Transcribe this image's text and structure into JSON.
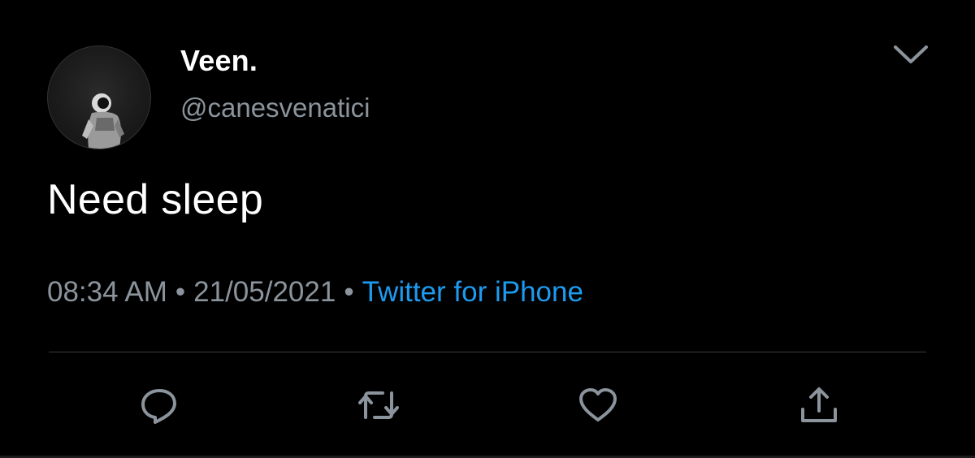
{
  "tweet": {
    "display_name": "Veen.",
    "handle": "@canesvenatici",
    "text": "Need sleep",
    "time": "08:34 AM",
    "date": "21/05/2021",
    "separator": "•",
    "source": "Twitter for iPhone"
  },
  "icons": {
    "menu": "chevron-down-icon",
    "reply": "reply-icon",
    "retweet": "retweet-icon",
    "like": "heart-icon",
    "share": "share-icon"
  },
  "colors": {
    "background": "#000000",
    "text": "#ffffff",
    "secondary_text": "#8b949c",
    "link": "#1d9bf0",
    "divider": "#3a3d40"
  }
}
